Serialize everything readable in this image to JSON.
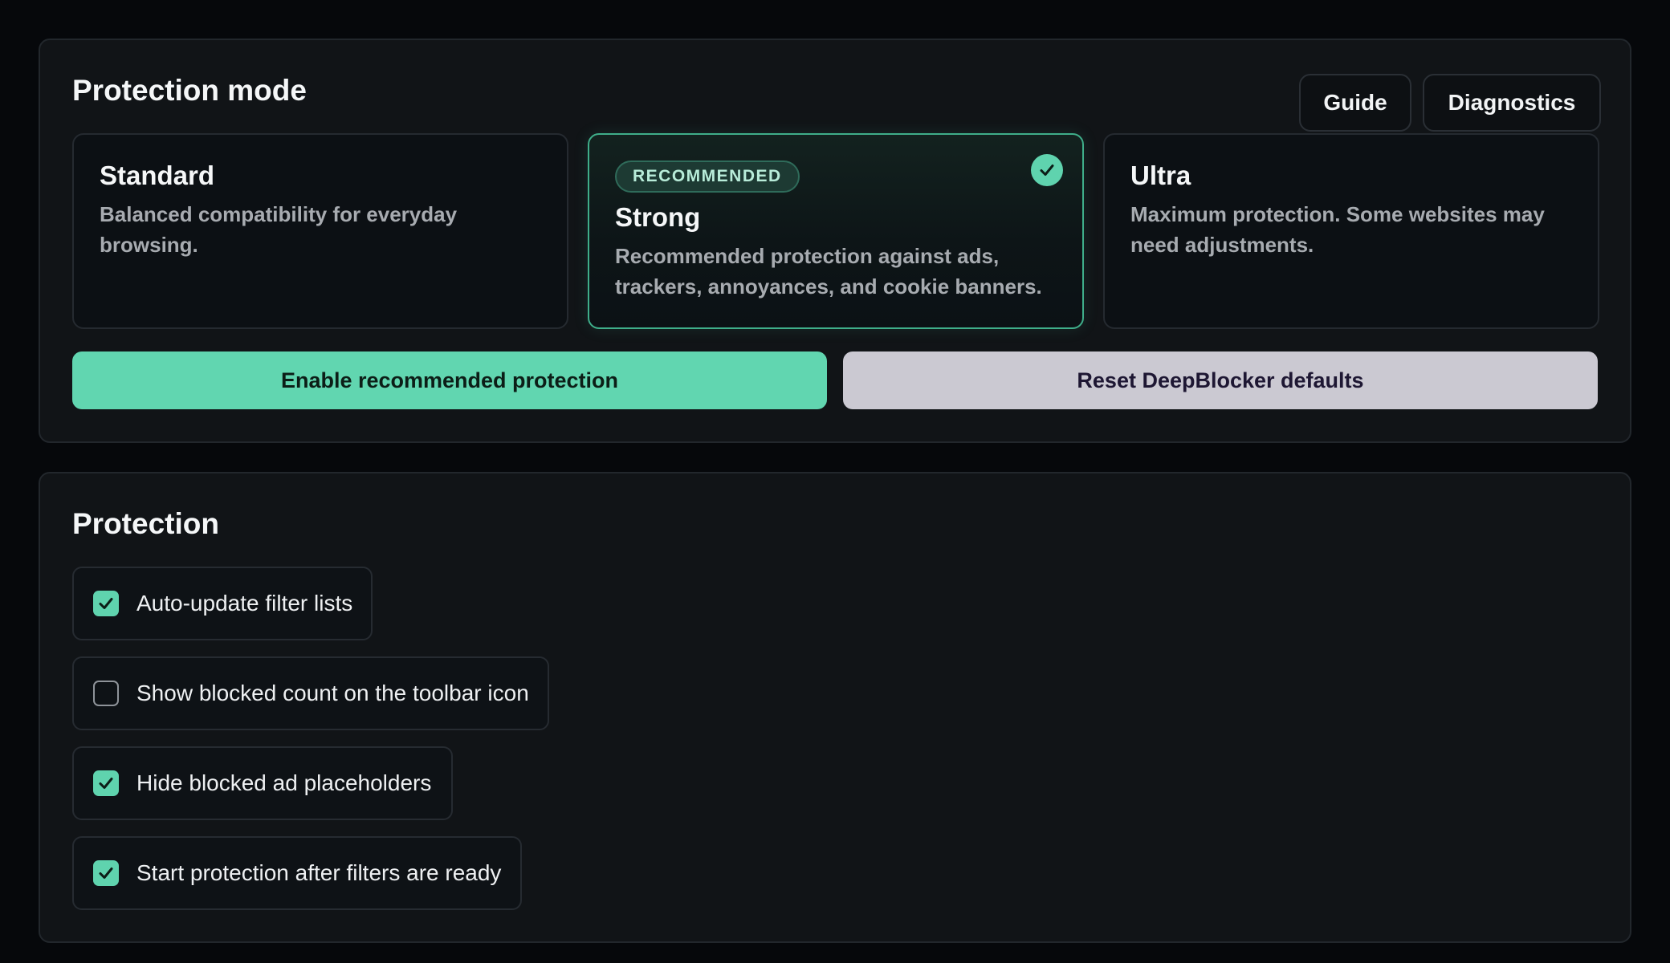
{
  "mode_panel": {
    "title": "Protection mode",
    "guide_label": "Guide",
    "diagnostics_label": "Diagnostics",
    "cards": {
      "standard": {
        "name": "Standard",
        "description": "Balanced compatibility for everyday browsing."
      },
      "strong": {
        "badge": "RECOMMENDED",
        "name": "Strong",
        "description": "Recommended protection against ads, trackers, annoyances, and cookie banners.",
        "selected": true
      },
      "ultra": {
        "name": "Ultra",
        "description": "Maximum protection. Some websites may need adjustments."
      }
    },
    "enable_label": "Enable recommended protection",
    "reset_label": "Reset DeepBlocker defaults"
  },
  "protection_panel": {
    "title": "Protection",
    "options": [
      {
        "label": "Auto-update filter lists",
        "checked": true
      },
      {
        "label": "Show blocked count on the toolbar icon",
        "checked": false
      },
      {
        "label": "Hide blocked ad placeholders",
        "checked": true
      },
      {
        "label": "Start protection after filters are ready",
        "checked": true
      }
    ]
  },
  "colors": {
    "accent": "#61d6b0",
    "background": "#06080b",
    "panel": "#111417",
    "secondary_button": "#cbc9d2"
  },
  "icons": {
    "selected_mark": "checkmark-icon",
    "checkbox_checked": "checkbox-checked-icon",
    "checkbox_unchecked": "checkbox-empty-icon"
  }
}
